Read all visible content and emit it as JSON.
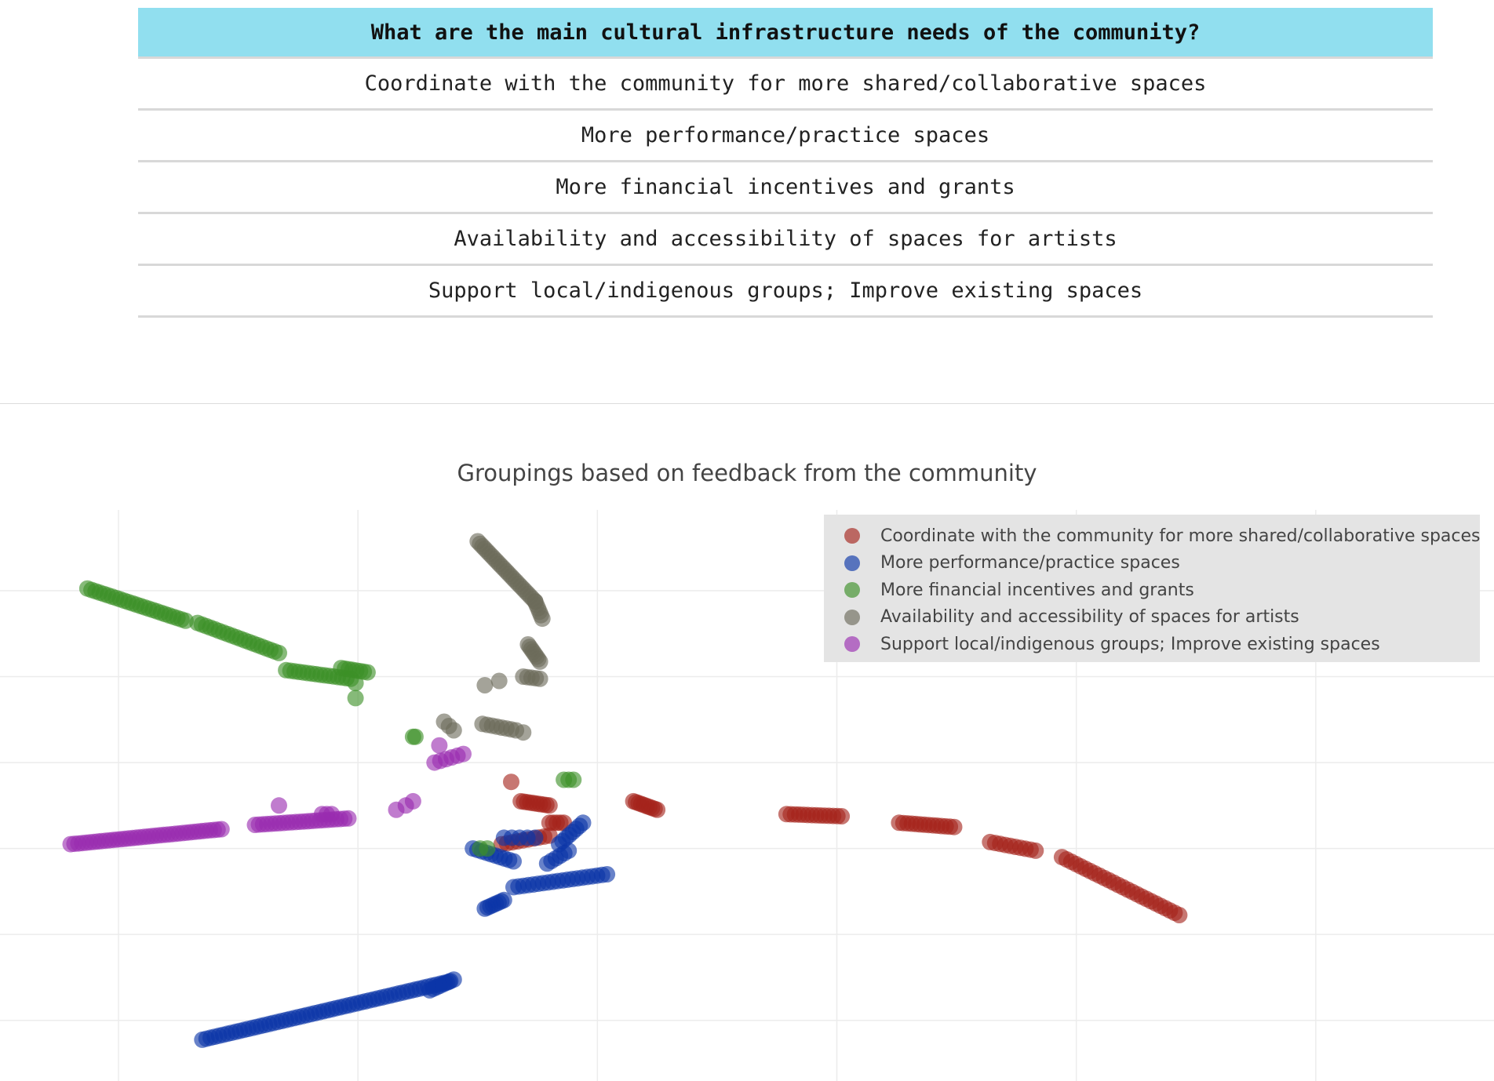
{
  "table": {
    "header": "What are the main cultural infrastructure needs of the community?",
    "rows": [
      "Coordinate with the community for more shared/collaborative spaces",
      "More performance/practice spaces",
      "More financial incentives and grants",
      "Availability and accessibility of spaces for artists",
      "Support local/indigenous groups; Improve existing spaces"
    ]
  },
  "chart_data": {
    "type": "scatter",
    "title": "Groupings based on feedback from the community",
    "xlabel": "",
    "ylabel": "",
    "x_range": [
      -1.0,
      4.62
    ],
    "y_range": [
      -1.18,
      1.23
    ],
    "grid": true,
    "legend_position": "top-right",
    "series": [
      {
        "name": "Coordinate with the community for more shared/collaborative spaces",
        "color": "#a5231c",
        "segments": [
          {
            "from": [
              0.84,
              0.11
            ],
            "to": [
              0.84,
              0.11
            ],
            "n": 1
          },
          {
            "from": [
              0.88,
              0.02
            ],
            "to": [
              1.0,
              0.0
            ],
            "n": 10
          },
          {
            "from": [
              1.0,
              -0.08
            ],
            "to": [
              1.06,
              -0.08
            ],
            "n": 5
          },
          {
            "from": [
              0.8,
              -0.18
            ],
            "to": [
              1.0,
              -0.14
            ],
            "n": 10
          },
          {
            "from": [
              1.35,
              0.02
            ],
            "to": [
              1.45,
              -0.02
            ],
            "n": 10
          },
          {
            "from": [
              1.99,
              -0.04
            ],
            "to": [
              2.22,
              -0.05
            ],
            "n": 14
          },
          {
            "from": [
              2.46,
              -0.08
            ],
            "to": [
              2.69,
              -0.1
            ],
            "n": 14
          },
          {
            "from": [
              2.84,
              -0.17
            ],
            "to": [
              3.03,
              -0.21
            ],
            "n": 10
          },
          {
            "from": [
              3.14,
              -0.24
            ],
            "to": [
              3.63,
              -0.51
            ],
            "n": 26
          }
        ]
      },
      {
        "name": "More performance/practice spaces",
        "color": "#0b36a8",
        "segments": [
          {
            "from": [
              -0.45,
              -1.09
            ],
            "to": [
              0.58,
              -0.82
            ],
            "n": 60
          },
          {
            "from": [
              0.5,
              -0.86
            ],
            "to": [
              0.6,
              -0.81
            ],
            "n": 8
          },
          {
            "from": [
              0.73,
              -0.48
            ],
            "to": [
              0.81,
              -0.44
            ],
            "n": 8
          },
          {
            "from": [
              0.85,
              -0.38
            ],
            "to": [
              1.24,
              -0.32
            ],
            "n": 20
          },
          {
            "from": [
              0.68,
              -0.2
            ],
            "to": [
              0.85,
              -0.26
            ],
            "n": 10
          },
          {
            "from": [
              0.81,
              -0.15
            ],
            "to": [
              0.94,
              -0.15
            ],
            "n": 5
          },
          {
            "from": [
              1.04,
              -0.18
            ],
            "to": [
              1.14,
              -0.08
            ],
            "n": 8
          },
          {
            "from": [
              0.99,
              -0.27
            ],
            "to": [
              1.08,
              -0.21
            ],
            "n": 6
          }
        ]
      },
      {
        "name": "More financial incentives and grants",
        "color": "#3b8f27",
        "segments": [
          {
            "from": [
              -0.93,
              1.01
            ],
            "to": [
              -0.52,
              0.86
            ],
            "n": 25
          },
          {
            "from": [
              -0.47,
              0.85
            ],
            "to": [
              -0.13,
              0.71
            ],
            "n": 20
          },
          {
            "from": [
              -0.1,
              0.63
            ],
            "to": [
              0.17,
              0.59
            ],
            "n": 16
          },
          {
            "from": [
              0.13,
              0.64
            ],
            "to": [
              0.24,
              0.62
            ],
            "n": 8
          },
          {
            "from": [
              0.19,
              0.57
            ],
            "to": [
              0.19,
              0.57
            ],
            "n": 1
          },
          {
            "from": [
              0.19,
              0.5
            ],
            "to": [
              0.19,
              0.5
            ],
            "n": 1
          },
          {
            "from": [
              0.43,
              0.32
            ],
            "to": [
              0.44,
              0.32
            ],
            "n": 2
          },
          {
            "from": [
              1.06,
              0.12
            ],
            "to": [
              1.1,
              0.12
            ],
            "n": 3
          },
          {
            "from": [
              0.71,
              -0.2
            ],
            "to": [
              0.74,
              -0.2
            ],
            "n": 2
          }
        ]
      },
      {
        "name": "Availability and accessibility of spaces for artists",
        "color": "#6c6a5a",
        "segments": [
          {
            "from": [
              0.7,
              1.23
            ],
            "to": [
              0.94,
              0.95
            ],
            "n": 25
          },
          {
            "from": [
              0.94,
              0.95
            ],
            "to": [
              0.97,
              0.87
            ],
            "n": 6
          },
          {
            "from": [
              0.91,
              0.75
            ],
            "to": [
              0.96,
              0.67
            ],
            "n": 8
          },
          {
            "from": [
              0.89,
              0.6
            ],
            "to": [
              0.96,
              0.59
            ],
            "n": 5
          },
          {
            "from": [
              0.73,
              0.56
            ],
            "to": [
              0.73,
              0.56
            ],
            "n": 1
          },
          {
            "from": [
              0.72,
              0.38
            ],
            "to": [
              0.86,
              0.35
            ],
            "n": 8
          },
          {
            "from": [
              0.89,
              0.34
            ],
            "to": [
              0.89,
              0.34
            ],
            "n": 1
          },
          {
            "from": [
              0.56,
              0.39
            ],
            "to": [
              0.6,
              0.35
            ],
            "n": 3
          },
          {
            "from": [
              0.79,
              0.58
            ],
            "to": [
              0.79,
              0.58
            ],
            "n": 1
          }
        ]
      },
      {
        "name": "Support local/indigenous groups; Improve existing spaces",
        "color": "#9a2cb0",
        "segments": [
          {
            "from": [
              -1.0,
              -0.18
            ],
            "to": [
              -0.37,
              -0.11
            ],
            "n": 40
          },
          {
            "from": [
              -0.23,
              -0.09
            ],
            "to": [
              0.16,
              -0.06
            ],
            "n": 24
          },
          {
            "from": [
              -0.13,
              0.0
            ],
            "to": [
              -0.13,
              0.0
            ],
            "n": 1
          },
          {
            "from": [
              0.05,
              -0.04
            ],
            "to": [
              0.09,
              -0.04
            ],
            "n": 3
          },
          {
            "from": [
              0.36,
              -0.02
            ],
            "to": [
              0.36,
              -0.02
            ],
            "n": 1
          },
          {
            "from": [
              0.4,
              0.0
            ],
            "to": [
              0.43,
              0.02
            ],
            "n": 2
          },
          {
            "from": [
              0.52,
              0.2
            ],
            "to": [
              0.64,
              0.24
            ],
            "n": 6
          },
          {
            "from": [
              0.54,
              0.28
            ],
            "to": [
              0.54,
              0.28
            ],
            "n": 1
          }
        ]
      }
    ]
  }
}
